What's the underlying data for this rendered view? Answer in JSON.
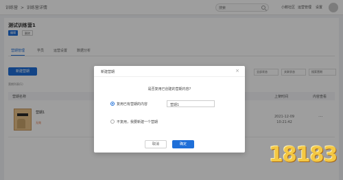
{
  "topbar": {
    "breadcrumb": [
      "训练营",
      "训练营详情"
    ],
    "breadcrumb_sep": ">",
    "search_placeholder": "搜索",
    "nav": [
      "小鹅社区",
      "运营管理",
      "设置"
    ]
  },
  "header": {
    "title": "测试训练营1",
    "edit_label": "编辑",
    "delete_label": "删除"
  },
  "tabs": [
    {
      "label": "营期管理",
      "active": true
    },
    {
      "label": "学员",
      "active": false
    },
    {
      "label": "运营设置",
      "active": false
    },
    {
      "label": "数据分析",
      "active": false
    }
  ],
  "toolbar": {
    "new_button": "新建营期",
    "filter_1": "全部状态",
    "filter_2": "关联状态",
    "filter_3": "搜索营期"
  },
  "list": {
    "count_text": "营期列表(1)",
    "columns": [
      "营期名称",
      "上架时间",
      "内容查看"
    ],
    "rows": [
      {
        "name": "营期1",
        "note": "无效",
        "date": "2021-12-09",
        "time": "10:21:42",
        "more": "···"
      }
    ]
  },
  "modal": {
    "title": "新建营期",
    "close": "×",
    "question": "是否复用已创建的营期内容?",
    "option_reuse": "复用已有营期的内容",
    "option_reuse_value": "营期1",
    "option_new": "不复用，我要新建一个营期",
    "cancel": "取消",
    "confirm": "确定"
  },
  "watermark": "18183",
  "colors": {
    "accent": "#1f6fd8",
    "overlay": "rgba(0,0,0,0.38)"
  }
}
